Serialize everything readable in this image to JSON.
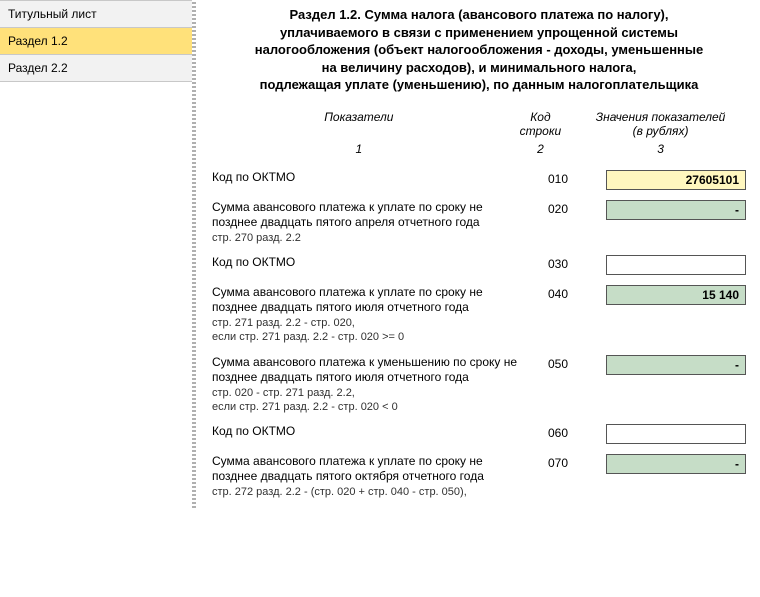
{
  "nav": {
    "items": [
      {
        "label": "Титульный лист"
      },
      {
        "label": "Раздел 1.2"
      },
      {
        "label": "Раздел 2.2"
      }
    ],
    "active_index": 1
  },
  "section": {
    "title_l1": "Раздел 1.2. Сумма налога (авансового платежа по налогу),",
    "title_l2": "уплачиваемого в связи с применением упрощенной системы",
    "title_l3": "налогообложения (объект налогообложения - доходы, уменьшенные",
    "title_l4": "на величину расходов), и минимального налога,",
    "title_l5": "подлежащая уплате (уменьшению), по данным налогоплательщика"
  },
  "columns": {
    "c1": "Показатели",
    "c2_l1": "Код",
    "c2_l2": "строки",
    "c3_l1": "Значения показателей",
    "c3_l2": "(в рублях)",
    "n1": "1",
    "n2": "2",
    "n3": "3"
  },
  "rows": [
    {
      "label": "Код по ОКТМО",
      "sub": "",
      "code": "010",
      "value": "27605101",
      "style": "yellow"
    },
    {
      "label": "Сумма авансового платежа к уплате по сроку не позднее двадцать пятого апреля отчетного года",
      "sub": "стр. 270 разд. 2.2",
      "code": "020",
      "value": "-",
      "style": "green"
    },
    {
      "label": "Код по ОКТМО",
      "sub": "",
      "code": "030",
      "value": "",
      "style": "white"
    },
    {
      "label": "Сумма  авансового платежа к уплате по сроку не позднее двадцать пятого июля отчетного года",
      "sub": "стр. 271 разд. 2.2 - стр. 020,\nесли стр. 271 разд. 2.2 - стр. 020 >= 0",
      "code": "040",
      "value": "15 140",
      "style": "green"
    },
    {
      "label": "Сумма авансового платежа к уменьшению по сроку не позднее двадцать пятого июля отчетного года",
      "sub": "стр. 020 - стр. 271 разд. 2.2,\nесли стр. 271 разд. 2.2 - стр. 020 < 0",
      "code": "050",
      "value": "-",
      "style": "green"
    },
    {
      "label": "Код по ОКТМО",
      "sub": "",
      "code": "060",
      "value": "",
      "style": "white"
    },
    {
      "label": "Сумма авансового платежа к уплате по сроку не позднее двадцать пятого октября отчетного года",
      "sub": "стр. 272 разд. 2.2 - (стр. 020 + стр. 040 - стр. 050),",
      "code": "070",
      "value": "-",
      "style": "green"
    }
  ]
}
